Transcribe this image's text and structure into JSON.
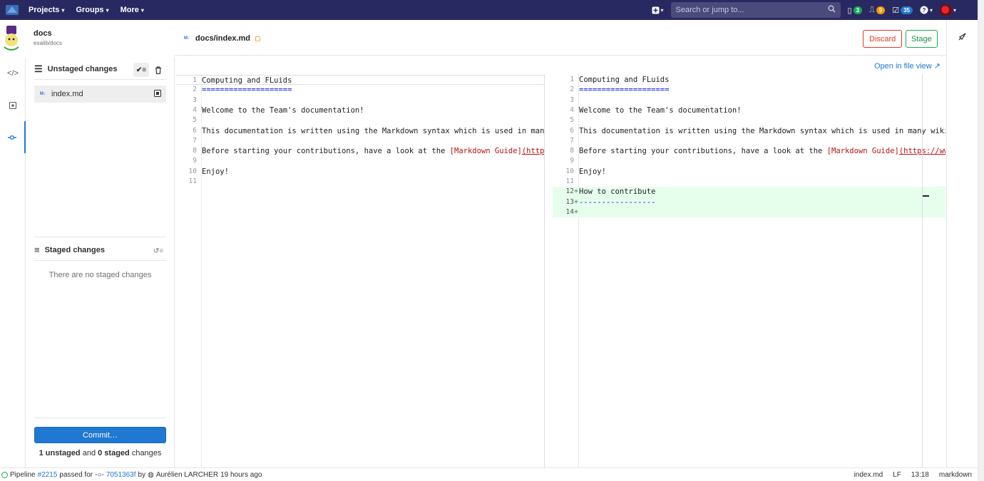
{
  "topbar": {
    "nav": [
      {
        "label": "Projects"
      },
      {
        "label": "Groups"
      },
      {
        "label": "More"
      }
    ],
    "search_placeholder": "Search or jump to...",
    "merge_requests_count": "3",
    "issues_count": "9",
    "todos_count": "35",
    "colors": {
      "bg": "#292961",
      "mr_badge": "#1aaa55",
      "issues_badge": "#fc9403",
      "todos_badge": "#1f78d1"
    }
  },
  "project": {
    "name": "docs",
    "path": "exalib/docs"
  },
  "changes": {
    "unstaged_title": "Unstaged changes",
    "unstaged_files": [
      {
        "name": "index.md"
      }
    ],
    "staged_title": "Staged changes",
    "staged_empty": "There are no staged changes",
    "commit_label": "Commit…",
    "summary": {
      "unstaged_count": "1 unstaged",
      "and": " and ",
      "staged_count": "0 staged",
      "suffix": " changes"
    }
  },
  "editor": {
    "file_path": "docs/index.md",
    "discard_label": "Discard",
    "stage_label": "Stage",
    "open_in_file_view": "Open in file view",
    "left_lines": [
      {
        "n": "1",
        "text": "Computing and FLuids"
      },
      {
        "n": "2",
        "text": "===================="
      },
      {
        "n": "3",
        "text": ""
      },
      {
        "n": "4",
        "text": "Welcome to the Team's documentation!"
      },
      {
        "n": "5",
        "text": ""
      },
      {
        "n": "6",
        "text": "This documentation is written using the Markdown syntax which is used in many wiki"
      },
      {
        "n": "7",
        "text": ""
      },
      {
        "n": "8",
        "text": "Before starting your contributions, have a look at the "
      },
      {
        "n": "9",
        "text": ""
      },
      {
        "n": "10",
        "text": "Enjoy!"
      },
      {
        "n": "11",
        "text": ""
      }
    ],
    "right_lines": [
      {
        "n": "1",
        "text": "Computing and FLuids"
      },
      {
        "n": "2",
        "text": "===================="
      },
      {
        "n": "3",
        "text": ""
      },
      {
        "n": "4",
        "text": "Welcome to the Team's documentation!"
      },
      {
        "n": "5",
        "text": ""
      },
      {
        "n": "6",
        "text": "This documentation is written using the Markdown syntax which is used in many wiki"
      },
      {
        "n": "7",
        "text": ""
      },
      {
        "n": "8",
        "text": "Before starting your contributions, have a look at the "
      },
      {
        "n": "9",
        "text": ""
      },
      {
        "n": "10",
        "text": "Enjoy!"
      },
      {
        "n": "11",
        "text": ""
      },
      {
        "n": "12",
        "text": "How to contribute"
      },
      {
        "n": "13",
        "text": "-----------------"
      },
      {
        "n": "14",
        "text": ""
      }
    ],
    "md_link_text": "[Markdown Guide]",
    "md_link_url": "(https://ww"
  },
  "status": {
    "pipeline_prefix": "Pipeline ",
    "pipeline_id": "#2215",
    "pipeline_mid": " passed for ",
    "commit_sha": "7051363f",
    "by": " by ",
    "author": "Aurélien LARCHER",
    "when": " 19 hours ago",
    "file": "index.md",
    "eol": "LF",
    "cursor": "13:18",
    "lang": "markdown"
  }
}
